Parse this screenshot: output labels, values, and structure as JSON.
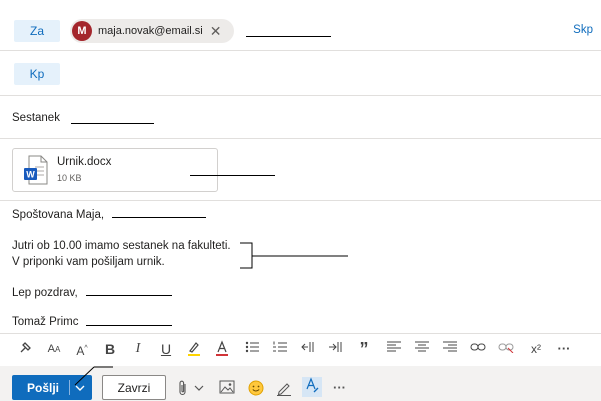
{
  "header": {
    "to_label": "Za",
    "recipient": {
      "initial": "M",
      "email": "maja.novak@email.si",
      "remove_glyph": "✕"
    },
    "bcc_label": "Skp",
    "cc_label": "Kp"
  },
  "subject": {
    "value": "Sestanek"
  },
  "attachment": {
    "filename": "Urnik.docx",
    "size": "10 KB",
    "icon": "word-doc-icon",
    "icon_letter": "W"
  },
  "body": {
    "greeting": "Spoštovana Maja,",
    "line1": "Jutri ob 10.00 imamo sestanek na fakulteti.",
    "line2": "V priponki vam pošiljam urnik.",
    "closing": "Lep pozdrav,",
    "signature": "Tomaž Primc"
  },
  "format_toolbar": {
    "bold": "B",
    "italic": "I",
    "underline": "U",
    "quote": "”",
    "superscript": "x²",
    "more": "···"
  },
  "actions": {
    "send_label": "Pošlji",
    "discard_label": "Zavrzi",
    "more": "···"
  },
  "colors": {
    "accent": "#0f6cbd",
    "avatar": "#a4262c",
    "word_blue": "#185abd"
  }
}
